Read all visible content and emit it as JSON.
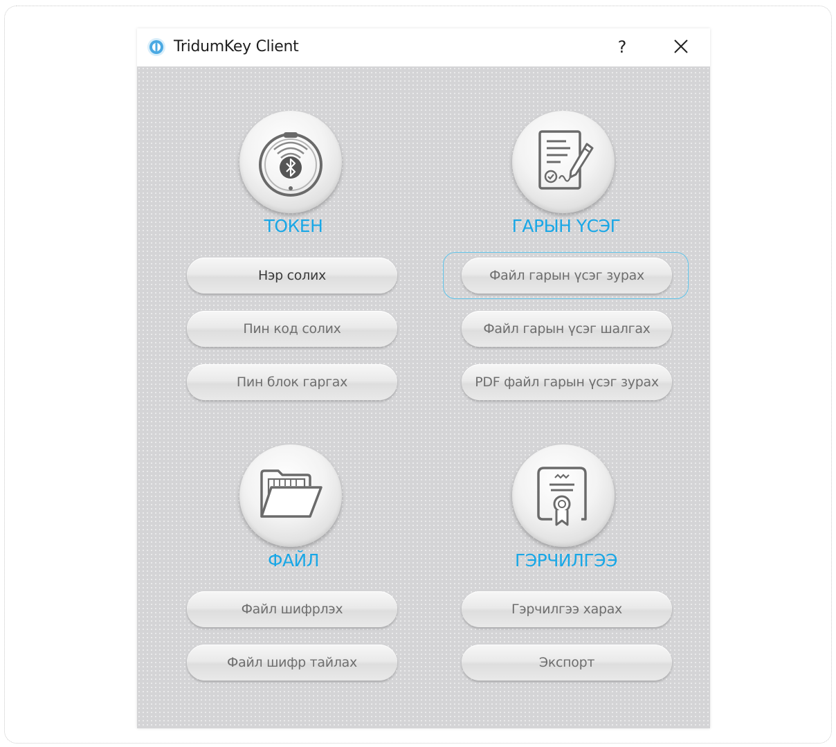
{
  "window": {
    "title": "TridumKey Client",
    "help_label": "?",
    "accent_color": "#19a7e6"
  },
  "sections": {
    "token": {
      "title": "ТОКЕН",
      "icon": "bluetooth-token-icon",
      "buttons": [
        "Нэр солих",
        "Пин код солих",
        "Пин блок гаргах"
      ]
    },
    "signature": {
      "title": "ГАРЫН ҮСЭГ",
      "icon": "document-sign-icon",
      "buttons": [
        "Файл гарын үсэг зурах",
        "Файл гарын үсэг шалгах",
        "PDF файл гарын үсэг зурах"
      ]
    },
    "file": {
      "title": "ФАЙЛ",
      "icon": "open-folder-icon",
      "buttons": [
        "Файл шифрлэх",
        "Файл шифр тайлах"
      ]
    },
    "certificate": {
      "title": "ГЭРЧИЛГЭЭ",
      "icon": "certificate-icon",
      "buttons": [
        "Гэрчилгээ харах",
        "Экспорт"
      ]
    }
  }
}
